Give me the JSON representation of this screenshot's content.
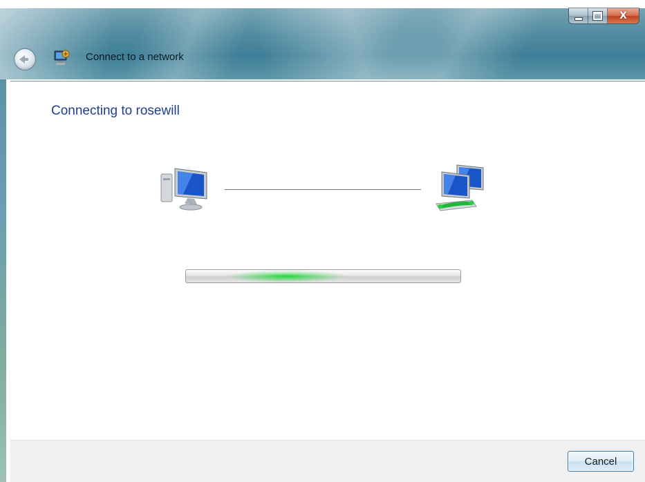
{
  "window": {
    "title": "Connect to a network",
    "caption_buttons": {
      "minimize": "minimize-icon",
      "maximize": "maximize-icon",
      "close": "X"
    }
  },
  "main": {
    "heading": "Connecting to rosewill",
    "progress_state": "indeterminate"
  },
  "footer": {
    "cancel_label": "Cancel"
  },
  "colors": {
    "heading": "#1e3f8a",
    "progress_glow": "#14dc32",
    "aero_glass": "#4f8aa0",
    "close_button": "#c0401f"
  },
  "icons": {
    "back": "back-arrow-icon",
    "title": "network-connect-icon",
    "source": "computer-icon",
    "destination": "network-computers-icon"
  }
}
